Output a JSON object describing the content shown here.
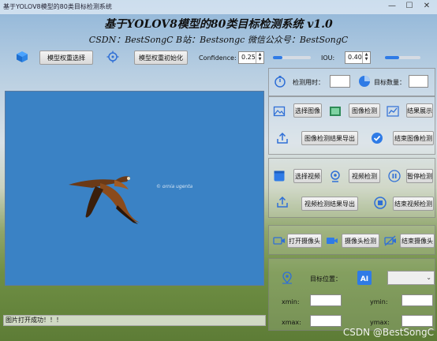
{
  "window": {
    "title": "基于YOLOV8模型的80类目标检测系统",
    "minimize": "—",
    "maximize": "☐",
    "close": "✕"
  },
  "header": {
    "title": "基于YOLOV8模型的80类目标检测系统 v1.0",
    "subtitle": "CSDN：BestSongC   B站：Bestsongc   微信公众号：BestSongC"
  },
  "toolbar": {
    "select_weights": "模型权重选择",
    "init_weights": "模型权重初始化",
    "confidence_label": "Confidence:",
    "confidence_value": "0.25",
    "confidence_level": 0.25,
    "iou_label": "IOU:",
    "iou_value": "0.40",
    "iou_level": 0.4
  },
  "stats": {
    "time_label": "检测用时：",
    "time_value": "",
    "count_label": "目标数量：",
    "count_value": ""
  },
  "image_section": {
    "select_image": "选择图像",
    "detect_image": "图像检测",
    "show_result": "结果展示",
    "export_result": "图像检测结果导出",
    "end_detect": "结束图像检测"
  },
  "video_section": {
    "select_video": "选择视频",
    "detect_video": "视频检测",
    "pause_detect": "暂停检测",
    "export_result": "视频检测结果导出",
    "end_detect": "结束视频检测"
  },
  "camera_section": {
    "open_camera": "打开摄像头",
    "detect_camera": "摄像头检测",
    "end_camera": "结束摄像头"
  },
  "target": {
    "position_label": "目标位置：",
    "combo_value": "",
    "xmin_label": "xmin:",
    "ymin_label": "ymin:",
    "xmax_label": "xmax:",
    "ymax_label": "ymax:",
    "xmin": "",
    "ymin": "",
    "xmax": "",
    "ymax": ""
  },
  "image_view": {
    "photo_credit": "© ornia ugenta"
  },
  "status": {
    "message": "图片打开成功！！！"
  },
  "watermark": "CSDN @BestSongC",
  "colors": {
    "accent": "#2f7be6",
    "image_bg": "#3a82c5"
  }
}
